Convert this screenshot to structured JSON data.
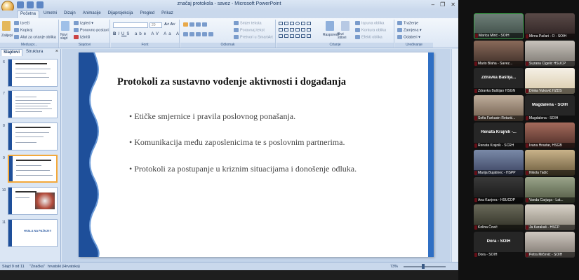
{
  "window": {
    "title": "značaj protokola - savez - Microsoft PowerPoint",
    "controls": [
      "–",
      "❐",
      "✕"
    ]
  },
  "ribbon_tabs": [
    "Početna",
    "Umetni",
    "Dizajn",
    "Animacije",
    "Dijaprojekcija",
    "Pregled",
    "Prikaz"
  ],
  "ribbon": {
    "clipboard": {
      "paste": "Zalijepi",
      "cut": "Izreži",
      "copy": "Kopiraj",
      "format_painter": "Alat za crtanje oblika",
      "label": "Međuspr..."
    },
    "slides": {
      "new_slide": "Novi slajd",
      "layout": "Izgled",
      "reset": "Ponovno postavi",
      "delete": "Izbriši",
      "label": "Slajdovi"
    },
    "font": {
      "label": "Font",
      "size": "20"
    },
    "paragraph": {
      "label": "Odlomak",
      "text_direction": "Smjer teksta",
      "align_text": "Poravnaj tekst",
      "convert_smartart": "Pretvori u SmartArt"
    },
    "drawing": {
      "label": "Crtanje",
      "arrange": "Rasporedi",
      "quick_styles": "Brzi stilovi",
      "fill": "Ispuna oblika",
      "outline": "Kontura oblika",
      "effects": "Efekti oblika"
    },
    "editing": {
      "label": "Uređivanje",
      "find": "Traženje",
      "replace": "Zamjena",
      "select": "Odaberi"
    }
  },
  "left_panel": {
    "tabs": [
      "Slajdovi",
      "Struktura"
    ],
    "close": "×",
    "slides": [
      {
        "num": "6"
      },
      {
        "num": "7"
      },
      {
        "num": "8"
      },
      {
        "num": "9"
      },
      {
        "num": "10"
      },
      {
        "num": "11",
        "caption": "HVALA NA PAŽNJI!!!"
      }
    ]
  },
  "slide": {
    "title": "Protokoli za sustavno vođenje aktivnosti i događanja",
    "bullets": [
      "• Etičke smjernice i pravila poslovnog  ponašanja.",
      "• Komunikacija među zaposlenicima te s poslovnim partnerima.",
      "• Protokoli za postupanje u kriznim situacijama i donošenje odluka."
    ]
  },
  "status_bar": {
    "slide_info": "Slajd 9 od 11",
    "theme": "\"Značka\"",
    "language": "hrvatski (Hrvatska)",
    "zoom": "73%"
  },
  "participants": [
    {
      "name": "Marica Mirić - SOIH",
      "active": true
    },
    {
      "name": "Mirna Pačari - O - SOIH"
    },
    {
      "name": "Mario Blaha - Savez..."
    },
    {
      "name": "Suzana Cigelić HSUCP"
    },
    {
      "name": "Zdravka Baštijan HSGN",
      "big": "Zdravka  Baštija..."
    },
    {
      "name": "Dinka Vuković HZDS"
    },
    {
      "name": "Sofia Farkasin Retarić..."
    },
    {
      "name": "Magdalena - SOIH",
      "big": "Magdalena - SOIH"
    },
    {
      "name": "Renata Krajnik - SCRH",
      "big": "Renata Krajnik -..."
    },
    {
      "name": "Ivana Hrastar, HSGB"
    },
    {
      "name": "Marija Bujatinec - HSPP"
    },
    {
      "name": "Nikola Tadić"
    },
    {
      "name": "Ana Kanjera - HSUCDP"
    },
    {
      "name": "Vanda Carjuga - Lat..."
    },
    {
      "name": "Kolina Čović"
    },
    {
      "name": "Ja Karakaš - HSCP"
    },
    {
      "name": "Dora - SOIH",
      "big": "Dora - SOIH"
    },
    {
      "name": "Petra Mrčević - SOIH"
    }
  ],
  "colors": {
    "accent": "#1e4f9a",
    "selection": "#f3a93b",
    "active_speaker": "#3fa34d"
  }
}
